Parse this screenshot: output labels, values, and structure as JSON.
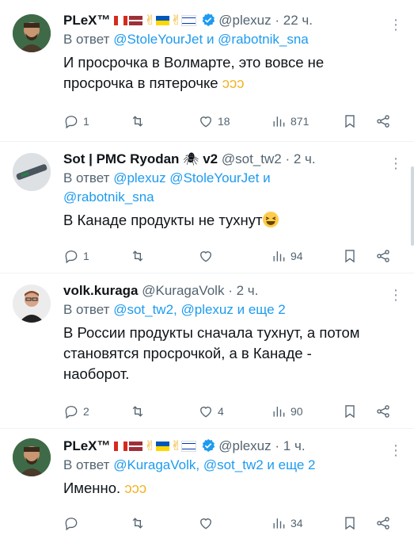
{
  "tweets": [
    {
      "name": "PLeX™",
      "handle": "@plexuz",
      "time": "22 ч.",
      "reply_prefix": "В ответ",
      "reply_mentions": "@StoleYourJet и @rabotnik_sna",
      "text": "И просрочка в Волмарте, это вовсе не просрочка в пятерочке",
      "replies": "1",
      "retweets": "",
      "likes": "18",
      "views": "871"
    },
    {
      "name": "Sot | PMC Ryodan",
      "name_suffix": "v2",
      "handle": "@sot_tw2",
      "time": "2 ч.",
      "reply_prefix": "В ответ",
      "reply_mentions_line1": "@plexuz @StoleYourJet и",
      "reply_mentions_line2": "@rabotnik_sna",
      "text": "В Канаде продукты не тухнут",
      "replies": "1",
      "retweets": "",
      "likes": "",
      "views": "94"
    },
    {
      "name": "volk.kuraga",
      "handle": "@KuragaVolk",
      "time": "2 ч.",
      "reply_prefix": "В ответ",
      "reply_mentions": "@sot_tw2, @plexuz и еще 2",
      "text_line1": "В России продукты сначала тухнут, а потом",
      "text_line2": "становятся просрочкой, а в Канаде -",
      "text_line3": "наоборот.",
      "replies": "2",
      "retweets": "",
      "likes": "4",
      "views": "90"
    },
    {
      "name": "PLeX™",
      "handle": "@plexuz",
      "time": "1 ч.",
      "reply_prefix": "В ответ",
      "reply_mentions": "@KuragaVolk, @sot_tw2 и еще 2",
      "text": "Именно.",
      "replies": "",
      "retweets": "",
      "likes": "",
      "views": "34"
    }
  ],
  "separator": "·",
  "icons": {
    "reply": "reply-icon",
    "retweet": "retweet-icon",
    "like": "heart-icon",
    "views": "views-chart-icon",
    "bookmark": "bookmark-icon",
    "share": "share-icon",
    "more": "more-dots-icon"
  },
  "colors": {
    "link": "#1d9bf0",
    "muted": "#536471",
    "text": "#0f1419",
    "verified": "#1d9bf0"
  }
}
